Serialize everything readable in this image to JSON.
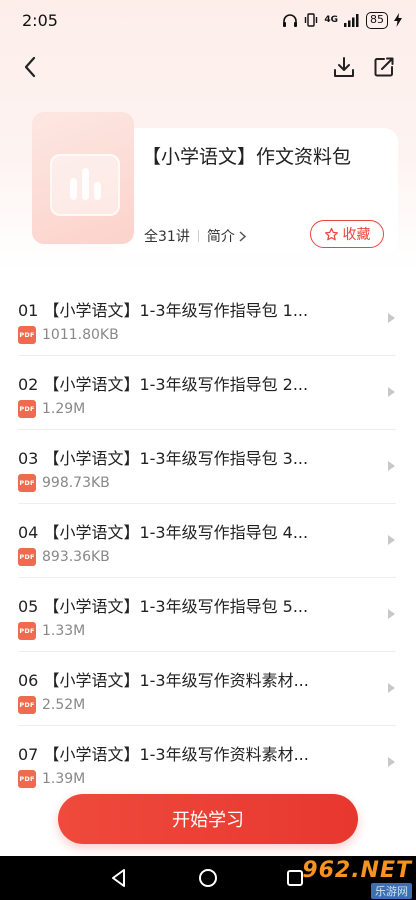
{
  "status_bar": {
    "time": "2:05",
    "network": "4G",
    "battery": "85"
  },
  "nav": {
    "back_icon": "chevron-left-icon",
    "download_icon": "download-icon",
    "share_icon": "share-icon"
  },
  "course": {
    "title": "【小学语文】作文资料包",
    "count": "全31讲",
    "intro_label": "简介",
    "favorite_label": "收藏"
  },
  "items": [
    {
      "title": "01 【小学语文】1-3年级写作指导包 1...",
      "badge": "PDF",
      "size": "1011.80KB"
    },
    {
      "title": "02 【小学语文】1-3年级写作指导包 2...",
      "badge": "PDF",
      "size": "1.29M"
    },
    {
      "title": "03 【小学语文】1-3年级写作指导包 3...",
      "badge": "PDF",
      "size": "998.73KB"
    },
    {
      "title": "04 【小学语文】1-3年级写作指导包 4...",
      "badge": "PDF",
      "size": "893.36KB"
    },
    {
      "title": "05 【小学语文】1-3年级写作指导包 5...",
      "badge": "PDF",
      "size": "1.33M"
    },
    {
      "title": "06 【小学语文】1-3年级写作资料素材...",
      "badge": "PDF",
      "size": "2.52M"
    },
    {
      "title": "07 【小学语文】1-3年级写作资料素材...",
      "badge": "PDF",
      "size": "1.39M"
    }
  ],
  "start_button": "开始学习",
  "watermark": {
    "top": "962.NET",
    "bottom": "乐游网"
  },
  "colors": {
    "accent": "#e8473f",
    "pdf": "#f06a4f"
  }
}
